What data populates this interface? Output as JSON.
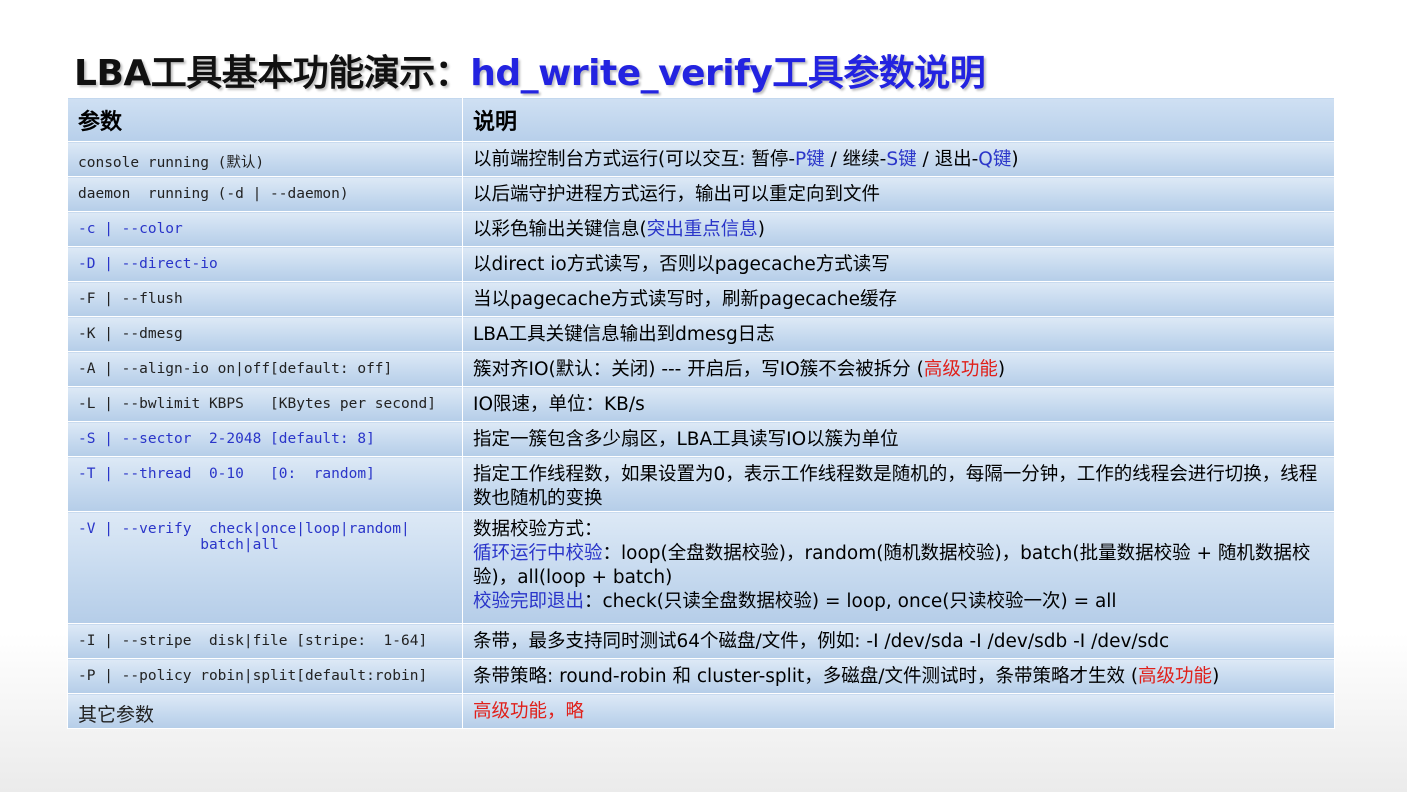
{
  "title": {
    "main": "LBA工具基本功能演示：",
    "accent": "hd_write_verify工具参数说明"
  },
  "table": {
    "headers": [
      "参数",
      "说明"
    ],
    "rows": [
      {
        "param": "console running (默认)",
        "desc": [
          "以前端控制台方式运行(可以交互: 暂停-",
          "P键",
          " / 继续-",
          "S键",
          " / 退出-",
          "Q键",
          ")"
        ]
      },
      {
        "param": "daemon  running (-d | --daemon)",
        "desc": [
          "以后端守护进程方式运行，输出可以重定向到文件"
        ]
      },
      {
        "param": "-c | --color",
        "desc": [
          "以彩色输出关键信息(",
          "突出重点信息",
          ")"
        ]
      },
      {
        "param": "-D | --direct-io",
        "desc": [
          "以direct io方式读写，否则以pagecache方式读写"
        ]
      },
      {
        "param": "-F | --flush",
        "desc": [
          "当以pagecache方式读写时，刷新pagecache缓存"
        ]
      },
      {
        "param": "-K | --dmesg",
        "desc": [
          "LBA工具关键信息输出到dmesg日志"
        ]
      },
      {
        "param": "-A | --align-io on|off[default: off]",
        "desc": [
          "簇对齐IO(默认：关闭) --- 开启后，写IO簇不会被拆分 (",
          "高级功能",
          ")"
        ]
      },
      {
        "param": "-L | --bwlimit KBPS   [KBytes per second]",
        "desc": [
          "IO限速，单位：KB/s"
        ]
      },
      {
        "param": "-S | --sector  2-2048 [default: 8]",
        "desc": [
          "指定一簇包含多少扇区，LBA工具读写IO以簇为单位"
        ]
      },
      {
        "param": "-T | --thread  0-10   [0:  random]",
        "desc": [
          "指定工作线程数，如果设置为0，表示工作线程数是随机的，每隔一分钟，工作的线程会进行切换，线程数也随机的变换"
        ]
      },
      {
        "param": "-V | --verify  check|once|loop|random|\n              batch|all",
        "desc": [
          "数据校验方式：",
          "循环运行中校验",
          "：loop(全盘数据校验)，random(随机数据校验)，batch(批量数据校验 + 随机数据校验)，all(loop + batch)",
          "校验完即退出",
          "：check(只读全盘数据校验) = loop, once(只读校验一次) = all"
        ]
      },
      {
        "param": "-I | --stripe  disk|file [stripe:  1-64]",
        "desc": [
          "条带，最多支持同时测试64个磁盘/文件，例如: -I /dev/sda -I /dev/sdb -I /dev/sdc"
        ]
      },
      {
        "param": "-P | --policy robin|split[default:robin]",
        "desc": [
          "条带策略: round-robin 和 cluster-split，多磁盘/文件测试时，条带策略才生效 (",
          "高级功能",
          ")"
        ]
      },
      {
        "param": "其它参数",
        "desc": [
          "高级功能，略"
        ]
      }
    ]
  },
  "colors": {
    "accent_blue": "#2323e0",
    "param_blue": "#2a35c9",
    "highlight_red": "#e0201a"
  }
}
